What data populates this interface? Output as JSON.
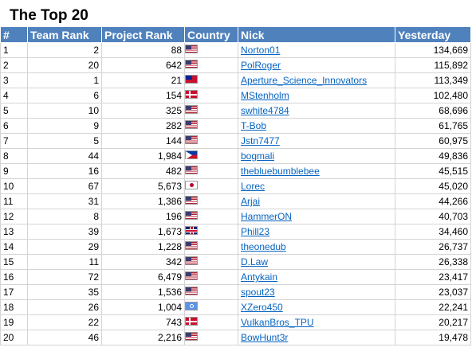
{
  "title": "The Top 20",
  "columns": [
    "#",
    "Team Rank",
    "Project Rank",
    "Country",
    "Nick",
    "Yesterday"
  ],
  "rows": [
    {
      "n": "1",
      "team": "2",
      "project": "88",
      "flag": "us",
      "nick": "Norton01",
      "yesterday": "134,669"
    },
    {
      "n": "2",
      "team": "20",
      "project": "642",
      "flag": "us",
      "nick": "PolRoger",
      "yesterday": "115,892"
    },
    {
      "n": "3",
      "team": "1",
      "project": "21",
      "flag": "tw",
      "nick": "Aperture_Science_Innovators",
      "yesterday": "113,349"
    },
    {
      "n": "4",
      "team": "6",
      "project": "154",
      "flag": "dk",
      "nick": "MStenholm",
      "yesterday": "102,480"
    },
    {
      "n": "5",
      "team": "10",
      "project": "325",
      "flag": "us",
      "nick": "swhite4784",
      "yesterday": "68,696"
    },
    {
      "n": "6",
      "team": "9",
      "project": "282",
      "flag": "us",
      "nick": "T-Bob",
      "yesterday": "61,765"
    },
    {
      "n": "7",
      "team": "5",
      "project": "144",
      "flag": "us",
      "nick": "Jstn7477",
      "yesterday": "60,975"
    },
    {
      "n": "8",
      "team": "44",
      "project": "1,984",
      "flag": "ph",
      "nick": "bogmali",
      "yesterday": "49,836"
    },
    {
      "n": "9",
      "team": "16",
      "project": "482",
      "flag": "us",
      "nick": "thebluebumblebee",
      "yesterday": "45,515"
    },
    {
      "n": "10",
      "team": "67",
      "project": "5,673",
      "flag": "jp",
      "nick": "Lorec",
      "yesterday": "45,020"
    },
    {
      "n": "11",
      "team": "31",
      "project": "1,386",
      "flag": "us",
      "nick": "Arjai",
      "yesterday": "44,266"
    },
    {
      "n": "12",
      "team": "8",
      "project": "196",
      "flag": "us",
      "nick": "HammerON",
      "yesterday": "40,703"
    },
    {
      "n": "13",
      "team": "39",
      "project": "1,673",
      "flag": "gb",
      "nick": "Phill23",
      "yesterday": "34,460"
    },
    {
      "n": "14",
      "team": "29",
      "project": "1,228",
      "flag": "us",
      "nick": "theonedub",
      "yesterday": "26,737"
    },
    {
      "n": "15",
      "team": "11",
      "project": "342",
      "flag": "us",
      "nick": "D.Law",
      "yesterday": "26,338"
    },
    {
      "n": "16",
      "team": "72",
      "project": "6,479",
      "flag": "us",
      "nick": "Antykain",
      "yesterday": "23,417"
    },
    {
      "n": "17",
      "team": "35",
      "project": "1,536",
      "flag": "us",
      "nick": "spout23",
      "yesterday": "23,037"
    },
    {
      "n": "18",
      "team": "26",
      "project": "1,004",
      "flag": "un",
      "nick": "XZero450",
      "yesterday": "22,241"
    },
    {
      "n": "19",
      "team": "22",
      "project": "743",
      "flag": "dk",
      "nick": "VulkanBros_TPU",
      "yesterday": "20,217"
    },
    {
      "n": "20",
      "team": "46",
      "project": "2,216",
      "flag": "us",
      "nick": "BowHunt3r",
      "yesterday": "19,478"
    }
  ],
  "colors": {
    "header_bg": "#4f81bd",
    "header_text": "#ffffff",
    "link": "#0563c1",
    "grid": "#d4d4d4"
  }
}
